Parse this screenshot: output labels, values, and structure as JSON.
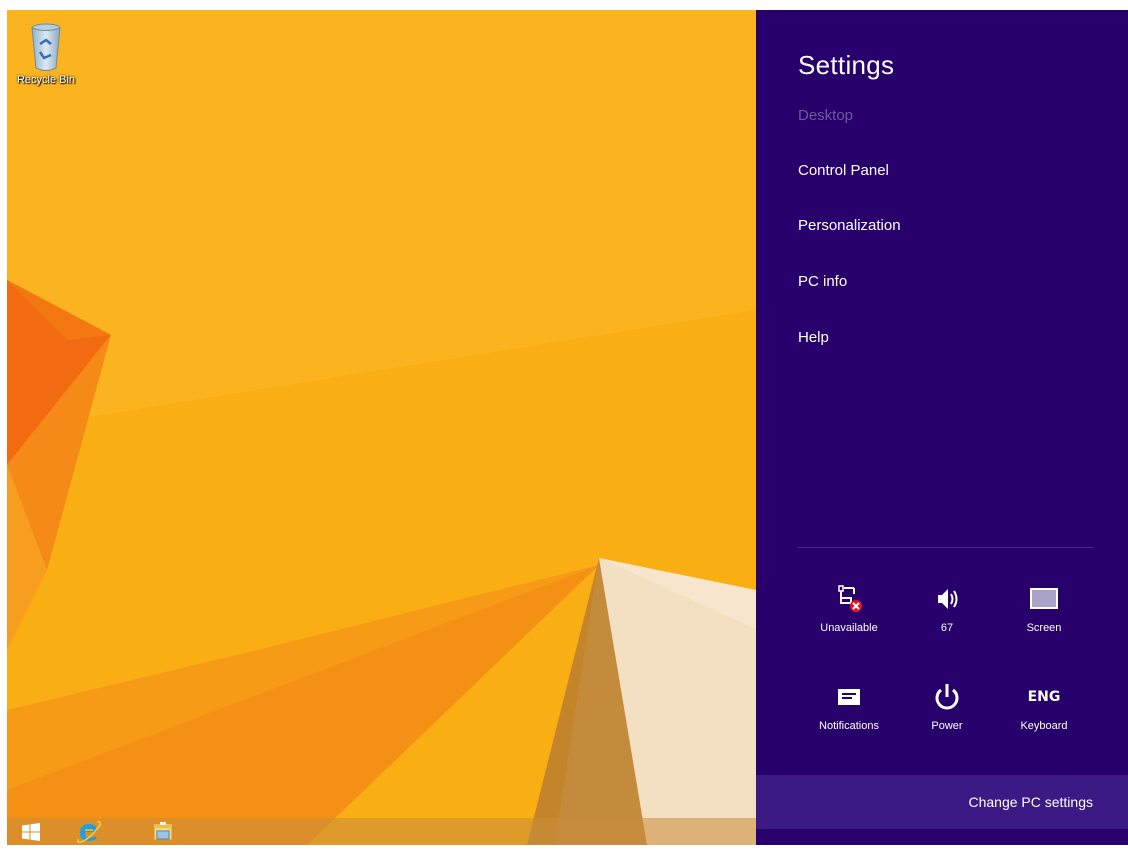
{
  "desktop": {
    "icons": [
      {
        "label": "Recycle Bin",
        "icon": "recycle-bin-icon"
      }
    ],
    "wallpaper_color": "#f9ad12"
  },
  "taskbar": {
    "buttons": [
      {
        "name": "start",
        "icon": "windows-logo-icon"
      },
      {
        "name": "internet-explorer",
        "icon": "internet-explorer-icon"
      },
      {
        "name": "file-explorer",
        "icon": "file-explorer-icon"
      }
    ]
  },
  "settings_panel": {
    "title": "Settings",
    "accent": "#27006b",
    "items": [
      {
        "label": "Desktop",
        "enabled": false
      },
      {
        "label": "Control Panel",
        "enabled": true
      },
      {
        "label": "Personalization",
        "enabled": true
      },
      {
        "label": "PC info",
        "enabled": true
      },
      {
        "label": "Help",
        "enabled": true
      }
    ],
    "quick_settings": [
      {
        "label": "Unavailable",
        "icon": "network-unavailable-icon"
      },
      {
        "label": "67",
        "icon": "volume-icon"
      },
      {
        "label": "Screen",
        "icon": "screen-brightness-icon"
      },
      {
        "label": "Notifications",
        "icon": "notifications-icon"
      },
      {
        "label": "Power",
        "icon": "power-icon"
      },
      {
        "label": "Keyboard",
        "icon": "keyboard-language-icon",
        "indicator": "ENG"
      }
    ],
    "footer_link": "Change PC settings"
  }
}
